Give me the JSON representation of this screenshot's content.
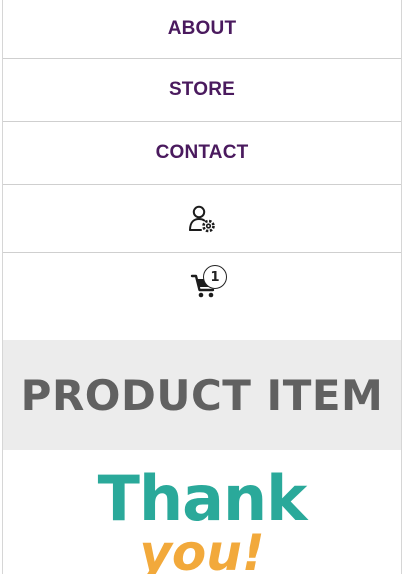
{
  "nav": {
    "items": [
      {
        "label": "ABOUT"
      },
      {
        "label": "STORE"
      },
      {
        "label": "CONTACT"
      }
    ],
    "account_icon": "user-settings-icon",
    "cart_icon": "shopping-cart-icon",
    "cart_count": "1"
  },
  "banner": {
    "title": "PRODUCT ITEM"
  },
  "thanks": {
    "line1": "Thank",
    "line2": "you!"
  },
  "colors": {
    "nav_text": "#4a1a5e",
    "banner_bg": "#ececec",
    "banner_text": "#616161",
    "thank_teal": "#2aa99a",
    "thank_orange": "#f2a93b"
  }
}
